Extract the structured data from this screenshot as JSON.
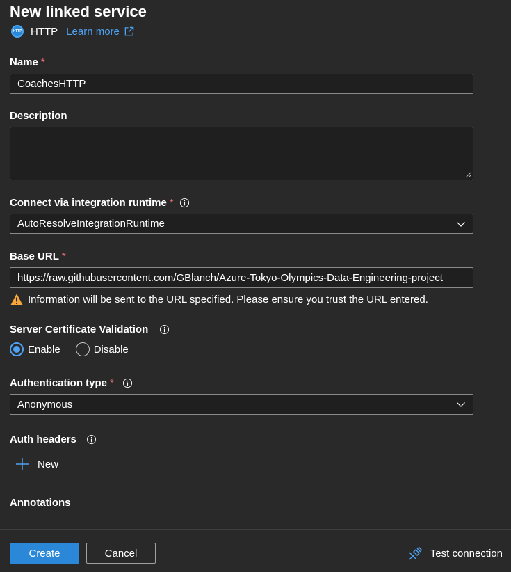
{
  "header": {
    "title": "New linked service",
    "connector_badge": "HTTP",
    "connector_name": "HTTP",
    "learn_more": "Learn more"
  },
  "fields": {
    "name": {
      "label": "Name",
      "required": "*",
      "value": "CoachesHTTP"
    },
    "description": {
      "label": "Description",
      "value": ""
    },
    "integration_runtime": {
      "label": "Connect via integration runtime",
      "required": "*",
      "value": "AutoResolveIntegrationRuntime"
    },
    "base_url": {
      "label": "Base URL",
      "required": "*",
      "value": "https://raw.githubusercontent.com/GBlanch/Azure-Tokyo-Olympics-Data-Engineering-project"
    },
    "warning": "Information will be sent to the URL specified. Please ensure you trust the URL entered.",
    "cert_validation": {
      "label": "Server Certificate Validation",
      "options": [
        "Enable",
        "Disable"
      ],
      "selected": "Enable"
    },
    "auth_type": {
      "label": "Authentication type",
      "required": "*",
      "value": "Anonymous"
    },
    "auth_headers": {
      "label": "Auth headers",
      "new_label": "New"
    },
    "annotations": {
      "label": "Annotations"
    }
  },
  "footer": {
    "create": "Create",
    "cancel": "Cancel",
    "test_connection": "Test connection"
  },
  "colors": {
    "background": "#292929",
    "accent": "#2b88d8",
    "link": "#4ea1f3",
    "required": "#f1707b",
    "warning": "#f7a53a"
  }
}
